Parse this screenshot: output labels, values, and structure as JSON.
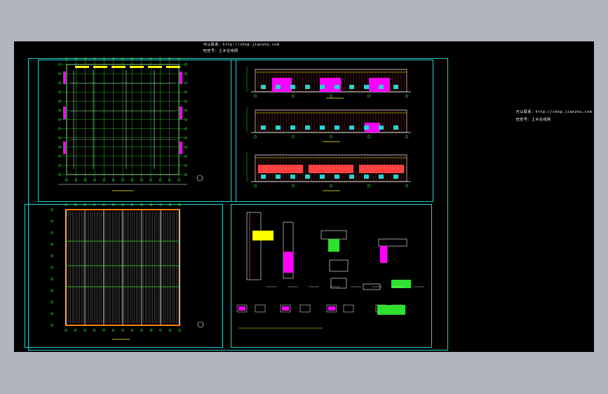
{
  "notes": {
    "top_line1": "可以联系：http://shop.jianzhu.com",
    "top_line2": "旺旺号：土木在线网",
    "right_line1": "可以联系：http://shop.jianzhu.com",
    "right_line2": "旺旺号：土木在线网"
  },
  "colors": {
    "background": "#b1b5bf",
    "viewport": "#000000",
    "frame": "#27d3d3",
    "grid": "#2fe02f",
    "highlight": "#ff00ff",
    "accent": "#ffff00",
    "line": "#ffffff"
  }
}
